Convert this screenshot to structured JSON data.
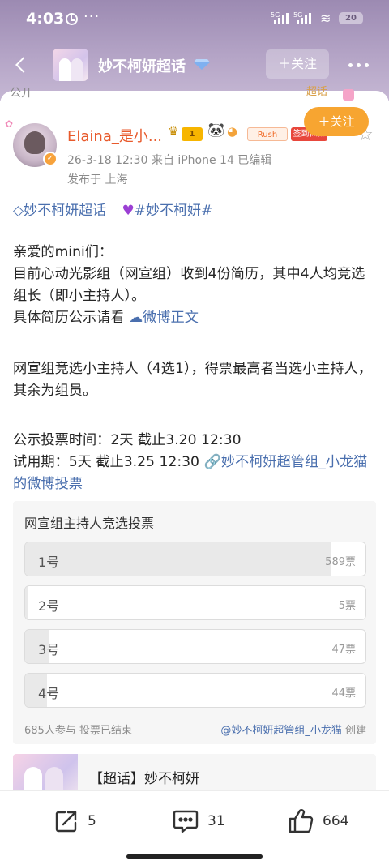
{
  "status_bar": {
    "time": "4:03",
    "dots": "···",
    "net1": "5G",
    "net2": "5G",
    "battery": "20"
  },
  "header": {
    "topic_title": "妙不柯妍超话",
    "follow_label": "＋关注"
  },
  "peek": {
    "text": "公开",
    "badge": "超话"
  },
  "post": {
    "author": "Elaina_是小...",
    "level_badge": "1",
    "rush_badge": "Rush",
    "sign_badge": "签到似锦",
    "meta_line": "26-3-18 12:30  来自 iPhone 14  已编辑",
    "location": "发布于 上海",
    "tags": [
      "妙不柯妍超话",
      "#妙不柯妍#"
    ],
    "lines": {
      "greeting": "亲爱的mini们：",
      "line2": "目前心动光影组（网宣组）收到4份简历，其中4人均竞选组长（即小主持人）。",
      "line3_prefix": "具体简历公示请看 ",
      "line3_link": "微博正文",
      "para2": "网宣组竞选小主持人（4选1），得票最高者当选小主持人，其余为组员。",
      "time_line": "公示投票时间：2天 截止3.20 12:30",
      "trial_prefix": "试用期：5天 截止3.25 12:30 ",
      "trial_link": "妙不柯妍超管组_小龙猫的微博投票"
    }
  },
  "poll": {
    "title": "网宣组主持人竞选投票",
    "options": [
      {
        "label": "1号",
        "count": "589票",
        "share": 0.9
      },
      {
        "label": "2号",
        "count": "5票",
        "share": 0.008
      },
      {
        "label": "3号",
        "count": "47票",
        "share": 0.07
      },
      {
        "label": "4号",
        "count": "44票",
        "share": 0.065
      }
    ],
    "footer_left": "685人参与  投票已结束",
    "creator": "@妙不柯妍超管组_小龙猫",
    "creator_suffix": " 创建"
  },
  "topic_card": {
    "name": "【超话】妙不柯妍",
    "follow_label": "＋关注"
  },
  "actions": {
    "share": "5",
    "comment": "31",
    "like": "664"
  }
}
